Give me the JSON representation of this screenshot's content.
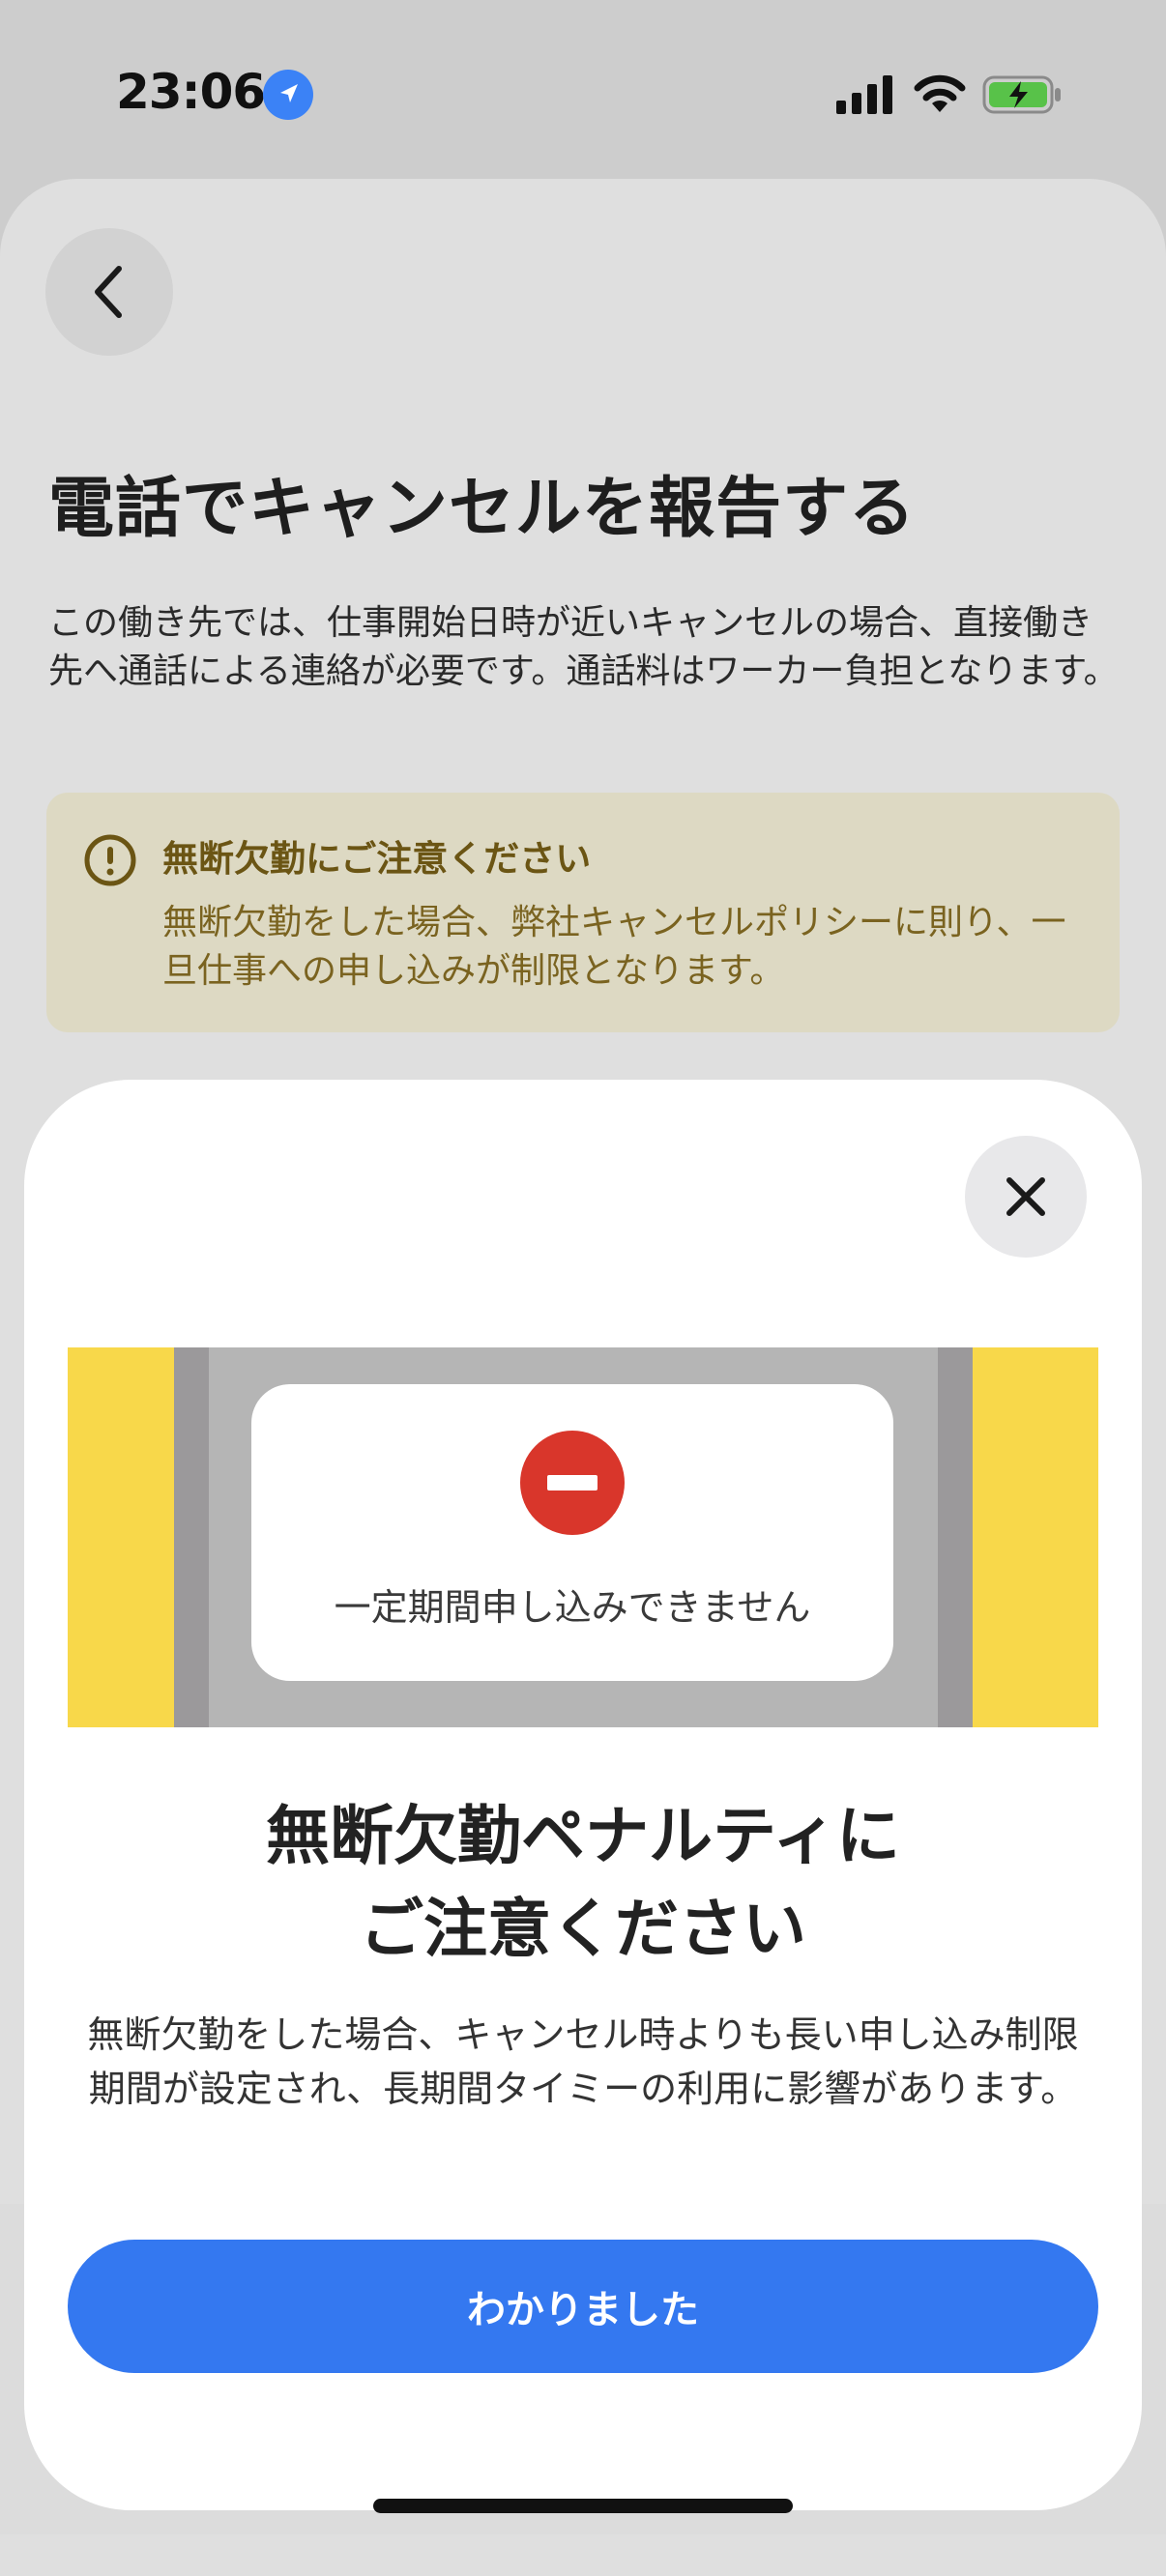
{
  "status_bar": {
    "time": "23:06"
  },
  "screen": {
    "title": "電話でキャンセルを報告する",
    "description": "この働き先では、仕事開始日時が近いキャンセルの場合、直接働き先へ通話による連絡が必要です。通話料はワーカー負担となります。",
    "notice": {
      "title": "無断欠勤にご注意ください",
      "text": "無断欠勤をした場合、弊社キャンセルポリシーに則り、一旦仕事への申し込みが制限となります。"
    }
  },
  "modal": {
    "illustration_text": "一定期間申し込みできません",
    "title_line1": "無断欠勤ペナルティに",
    "title_line2": "ご注意ください",
    "description": "無断欠勤をした場合、キャンセル時よりも長い申し込み制限期間が設定され、長期間タイミーの利用に影響があります。",
    "confirm_label": "わかりました"
  },
  "colors": {
    "accent": "#3478f0",
    "notice_bg": "#ddd9c3",
    "notice_text": "#7a6320",
    "illustration_yellow": "#f8d84a",
    "no_entry_red": "#d9362b"
  }
}
